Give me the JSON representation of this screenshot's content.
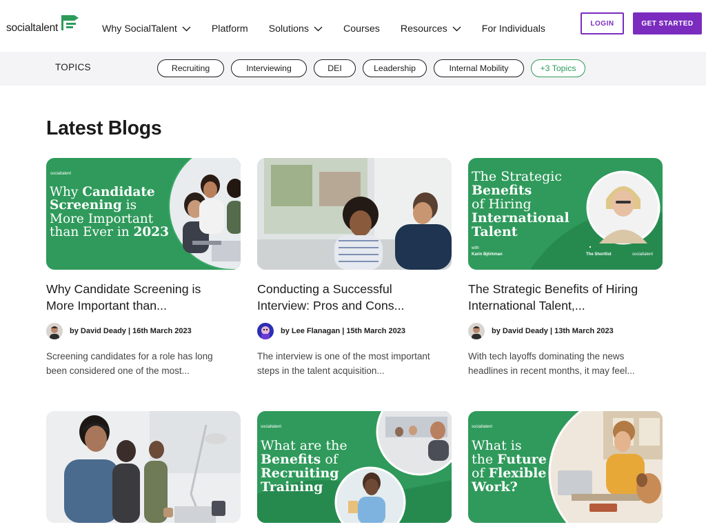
{
  "header": {
    "logo_text": "socialtalent",
    "nav": [
      {
        "label": "Why SocialTalent",
        "dropdown": true
      },
      {
        "label": "Platform",
        "dropdown": false
      },
      {
        "label": "Solutions",
        "dropdown": true
      },
      {
        "label": "Courses",
        "dropdown": false
      },
      {
        "label": "Resources",
        "dropdown": true
      },
      {
        "label": "For Individuals",
        "dropdown": false
      }
    ],
    "login_label": "LOGIN",
    "get_started_label": "GET STARTED"
  },
  "topics": {
    "label": "TOPICS",
    "pills": [
      "Recruiting",
      "Interviewing",
      "DEI",
      "Leadership",
      "Internal Mobility"
    ],
    "more_label": "+3 Topics"
  },
  "main": {
    "title": "Latest Blogs",
    "cards": [
      {
        "title_line1": "Why Candidate Screening is",
        "title_line2": "More Important than...",
        "meta": "by David Deady | 16th March 2023",
        "excerpt_line1": "Screening candidates for a role has long",
        "excerpt_line2": "been considered one of the most...",
        "thumb_brand": "socialtalent",
        "thumb_l1a": "Why ",
        "thumb_l1b": "Candidate",
        "thumb_l2a": "Screening",
        "thumb_l2b": " is",
        "thumb_l3": "More Important",
        "thumb_l4a": "than Ever in ",
        "thumb_l4b": "2023"
      },
      {
        "title_line1": "Conducting a Successful",
        "title_line2": "Interview: Pros and Cons...",
        "meta": "by Lee Flanagan | 15th March 2023",
        "excerpt_line1": "The interview is one of the most important",
        "excerpt_line2": "steps in the talent acquisition..."
      },
      {
        "title_line1": "The Strategic Benefits of Hiring",
        "title_line2": "International Talent,...",
        "meta": "by David Deady | 13th March 2023",
        "excerpt_line1": "With tech layoffs dominating the news",
        "excerpt_line2": "headlines in recent months, it may feel...",
        "thumb_l1": "The Strategic",
        "thumb_l2": "Benefits",
        "thumb_l3": "of Hiring",
        "thumb_l4": "International",
        "thumb_l5": "Talent",
        "thumb_with": "with",
        "thumb_guest": "Karin Björkman",
        "thumb_show": "The Shortlist",
        "thumb_brand": "socialtalent"
      },
      {},
      {
        "thumb_brand": "socialtalent",
        "thumb_l1": "What are the",
        "thumb_l2a": "Benefits",
        "thumb_l2b": " of",
        "thumb_l3": "Recruiting",
        "thumb_l4": "Training"
      },
      {
        "thumb_brand": "socialtalent",
        "thumb_l1": "What is",
        "thumb_l2a": "the ",
        "thumb_l2b": "Future",
        "thumb_l3a": "of ",
        "thumb_l3b": "Flexible",
        "thumb_l4": "Work?"
      }
    ]
  },
  "colors": {
    "brand_purple": "#7b2cbf",
    "brand_green": "#2e9b5a",
    "topics_bg": "#f4f4f6"
  }
}
